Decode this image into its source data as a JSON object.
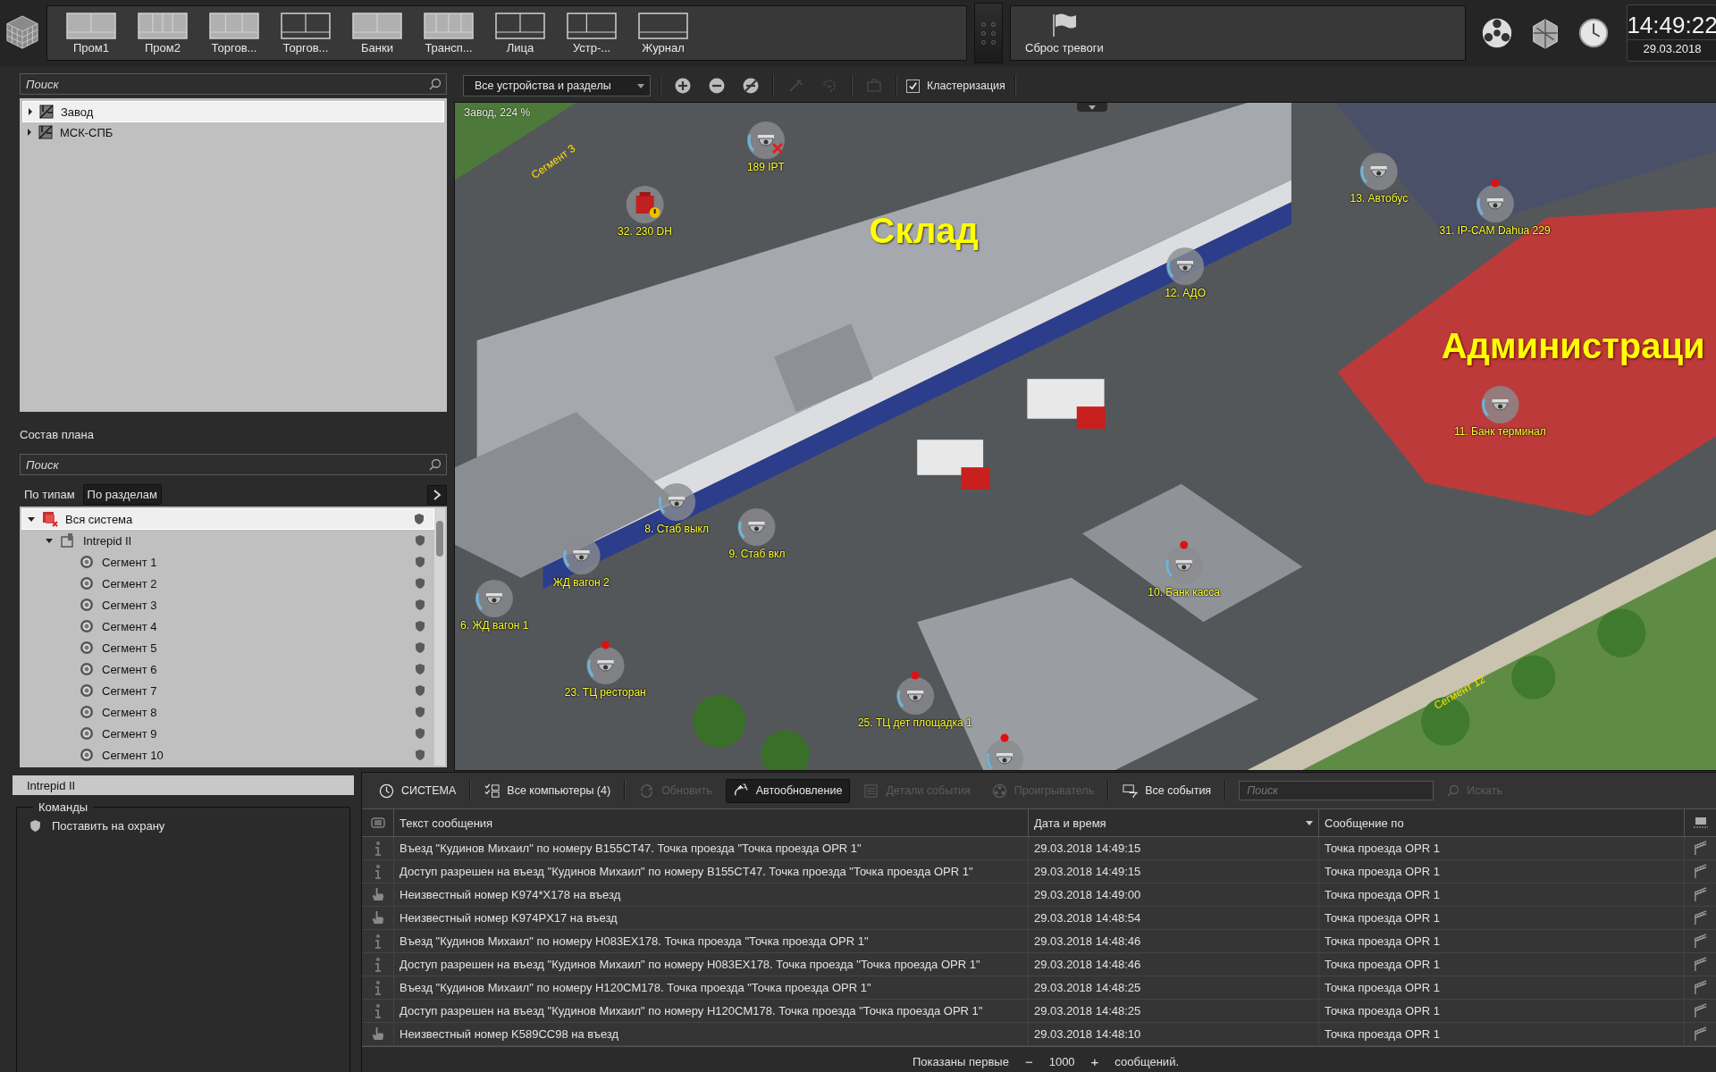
{
  "top_bar": {
    "layouts": [
      {
        "label": "Пром1"
      },
      {
        "label": "Пром2"
      },
      {
        "label": "Торгов..."
      },
      {
        "label": "Торгов..."
      },
      {
        "label": "Банки"
      },
      {
        "label": "Трансп..."
      },
      {
        "label": "Лица"
      },
      {
        "label": "Устр-..."
      },
      {
        "label": "Журнал"
      }
    ],
    "alarm_reset": {
      "label": "Сброс тревоги"
    },
    "clock": {
      "time": "14:49:22",
      "date": "29.03.2018"
    }
  },
  "left_panel": {
    "search": {
      "placeholder": "Поиск"
    },
    "plans": [
      {
        "label": "Завод",
        "selected": true
      },
      {
        "label": "МСК-СПБ",
        "selected": false
      }
    ],
    "plan_contents": {
      "title": "Состав плана",
      "search": {
        "placeholder": "Поиск"
      },
      "tabs": [
        {
          "label": "По типам",
          "selected": false
        },
        {
          "label": "По разделам",
          "selected": true
        }
      ],
      "tree": [
        {
          "label": "Вся система",
          "kind": "system",
          "selected": true,
          "expanded": true,
          "children": [
            {
              "label": "Intrepid II",
              "kind": "device",
              "selected": false,
              "expanded": true,
              "children": [
                {
                  "label": "Сегмент 1",
                  "kind": "segment",
                  "selected": false
                },
                {
                  "label": "Сегмент 2",
                  "kind": "segment",
                  "selected": false
                },
                {
                  "label": "Сегмент 3",
                  "kind": "segment",
                  "selected": false
                },
                {
                  "label": "Сегмент 4",
                  "kind": "segment",
                  "selected": false
                },
                {
                  "label": "Сегмент 5",
                  "kind": "segment",
                  "selected": false
                },
                {
                  "label": "Сегмент 6",
                  "kind": "segment",
                  "selected": false
                },
                {
                  "label": "Сегмент 7",
                  "kind": "segment",
                  "selected": false
                },
                {
                  "label": "Сегмент 8",
                  "kind": "segment",
                  "selected": false
                },
                {
                  "label": "Сегмент 9",
                  "kind": "segment",
                  "selected": false
                },
                {
                  "label": "Сегмент 10",
                  "kind": "segment",
                  "selected": false
                }
              ]
            }
          ]
        }
      ]
    }
  },
  "map": {
    "toolbar": {
      "filter": "Все устройства и разделы",
      "tools": [
        {
          "kind": "zoom-in",
          "disabled": false
        },
        {
          "kind": "zoom-out",
          "disabled": false
        },
        {
          "kind": "unlink",
          "disabled": false
        },
        {
          "kind": "wand",
          "disabled": true
        },
        {
          "kind": "rotate",
          "disabled": true
        },
        {
          "kind": "snapshot",
          "disabled": true
        }
      ],
      "clustering": {
        "label": "Кластеризация",
        "checked": true
      }
    },
    "caption": "Завод, 224 %",
    "zones": [
      {
        "label": "Склад",
        "alarm": false
      },
      {
        "label": "Администраци",
        "alarm": true
      }
    ],
    "segments": [
      {
        "label": "Сегмент 3"
      },
      {
        "label": "Сегмент 12"
      }
    ],
    "markers": [
      {
        "label": "189 IPT",
        "kind": "camera",
        "alarm": false,
        "fault": true
      },
      {
        "label": "32. 230 DH",
        "kind": "sensor",
        "alarm": false,
        "fault": false
      },
      {
        "label": "13. Автобус",
        "kind": "camera",
        "alarm": false,
        "fault": false
      },
      {
        "label": "31. IP-CAM Dahua 229",
        "kind": "camera",
        "alarm": true,
        "fault": false
      },
      {
        "label": "12. АДО",
        "kind": "camera",
        "alarm": false,
        "fault": false
      },
      {
        "label": "11. Банк терминал",
        "kind": "camera",
        "alarm": false,
        "fault": false
      },
      {
        "label": "8. Стаб выкл",
        "kind": "camera",
        "alarm": false,
        "fault": false
      },
      {
        "label": "9. Стаб вкл",
        "kind": "camera",
        "alarm": false,
        "fault": false
      },
      {
        "label": "ЖД вагон 2",
        "kind": "camera",
        "alarm": false,
        "fault": false
      },
      {
        "label": "6. ЖД вагон 1",
        "kind": "camera",
        "alarm": false,
        "fault": false
      },
      {
        "label": "10. Банк касса",
        "kind": "camera",
        "alarm": true,
        "fault": false
      },
      {
        "label": "23. ТЦ ресторан",
        "kind": "camera",
        "alarm": true,
        "fault": false
      },
      {
        "label": "25. ТЦ дет площадка 1",
        "kind": "camera",
        "alarm": true,
        "fault": false
      },
      {
        "kind": "camera",
        "alarm": true,
        "fault": false
      }
    ]
  },
  "object_panel": {
    "title": "Intrepid II",
    "group": "Команды",
    "commands": [
      {
        "label": "Поставить на охрану"
      }
    ]
  },
  "events": {
    "toolbar": [
      {
        "label": "СИСТЕМА",
        "kind": "clock",
        "disabled": false,
        "on": false
      },
      {
        "label": "Все компьютеры (4)",
        "kind": "computers",
        "disabled": false,
        "on": false
      },
      {
        "label": "Обновить",
        "kind": "refresh",
        "disabled": true,
        "on": false
      },
      {
        "label": "Автообновление",
        "kind": "auto",
        "disabled": false,
        "on": true
      },
      {
        "label": "Детали события",
        "kind": "details",
        "disabled": true,
        "on": false
      },
      {
        "label": "Проигрыватель",
        "kind": "player",
        "disabled": true,
        "on": false
      },
      {
        "label": "Все события",
        "kind": "filter",
        "disabled": false,
        "on": false
      }
    ],
    "search": {
      "placeholder": "Поиск"
    },
    "search_button": {
      "label": "Искать",
      "disabled": true
    },
    "columns": [
      {
        "label": "Текст сообщения",
        "sorted": false
      },
      {
        "label": "Дата и время",
        "sorted": true
      },
      {
        "label": "Сообщение по",
        "sorted": false
      }
    ],
    "rows": [
      {
        "kind": "info",
        "text": "Въезд \"Кудинов Михаил\" по номеру B155CT47. Точка проезда \"Точка проезда OPR 1\"",
        "time": "29.03.2018 14:49:15",
        "source": "Точка проезда OPR 1"
      },
      {
        "kind": "info",
        "text": "Доступ разрешен на въезд \"Кудинов Михаил\" по номеру B155CT47. Точка проезда \"Точка проезда OPR 1\"",
        "time": "29.03.2018 14:49:15",
        "source": "Точка проезда OPR 1"
      },
      {
        "kind": "hand",
        "text": "Неизвестный номер K974*X178 на въезд",
        "time": "29.03.2018 14:49:00",
        "source": "Точка проезда OPR 1"
      },
      {
        "kind": "hand",
        "text": "Неизвестный номер K974PX17 на въезд",
        "time": "29.03.2018 14:48:54",
        "source": "Точка проезда OPR 1"
      },
      {
        "kind": "info",
        "text": "Въезд \"Кудинов Михаил\" по номеру H083EX178. Точка проезда \"Точка проезда OPR 1\"",
        "time": "29.03.2018 14:48:46",
        "source": "Точка проезда OPR 1"
      },
      {
        "kind": "info",
        "text": "Доступ разрешен на въезд \"Кудинов Михаил\" по номеру H083EX178. Точка проезда \"Точка проезда OPR 1\"",
        "time": "29.03.2018 14:48:46",
        "source": "Точка проезда OPR 1"
      },
      {
        "kind": "info",
        "text": "Въезд \"Кудинов Михаил\" по номеру H120CM178. Точка проезда \"Точка проезда OPR 1\"",
        "time": "29.03.2018 14:48:25",
        "source": "Точка проезда OPR 1"
      },
      {
        "kind": "info",
        "text": "Доступ разрешен на въезд \"Кудинов Михаил\" по номеру H120CM178. Точка проезда \"Точка проезда OPR 1\"",
        "time": "29.03.2018 14:48:25",
        "source": "Точка проезда OPR 1"
      },
      {
        "kind": "hand",
        "text": "Неизвестный номер K589CC98 на въезд",
        "time": "29.03.2018 14:48:10",
        "source": "Точка проезда OPR 1"
      }
    ],
    "footer": {
      "prefix": "Показаны первые",
      "minus": "−",
      "count": "1000",
      "plus": "+",
      "suffix": "сообщений."
    }
  }
}
